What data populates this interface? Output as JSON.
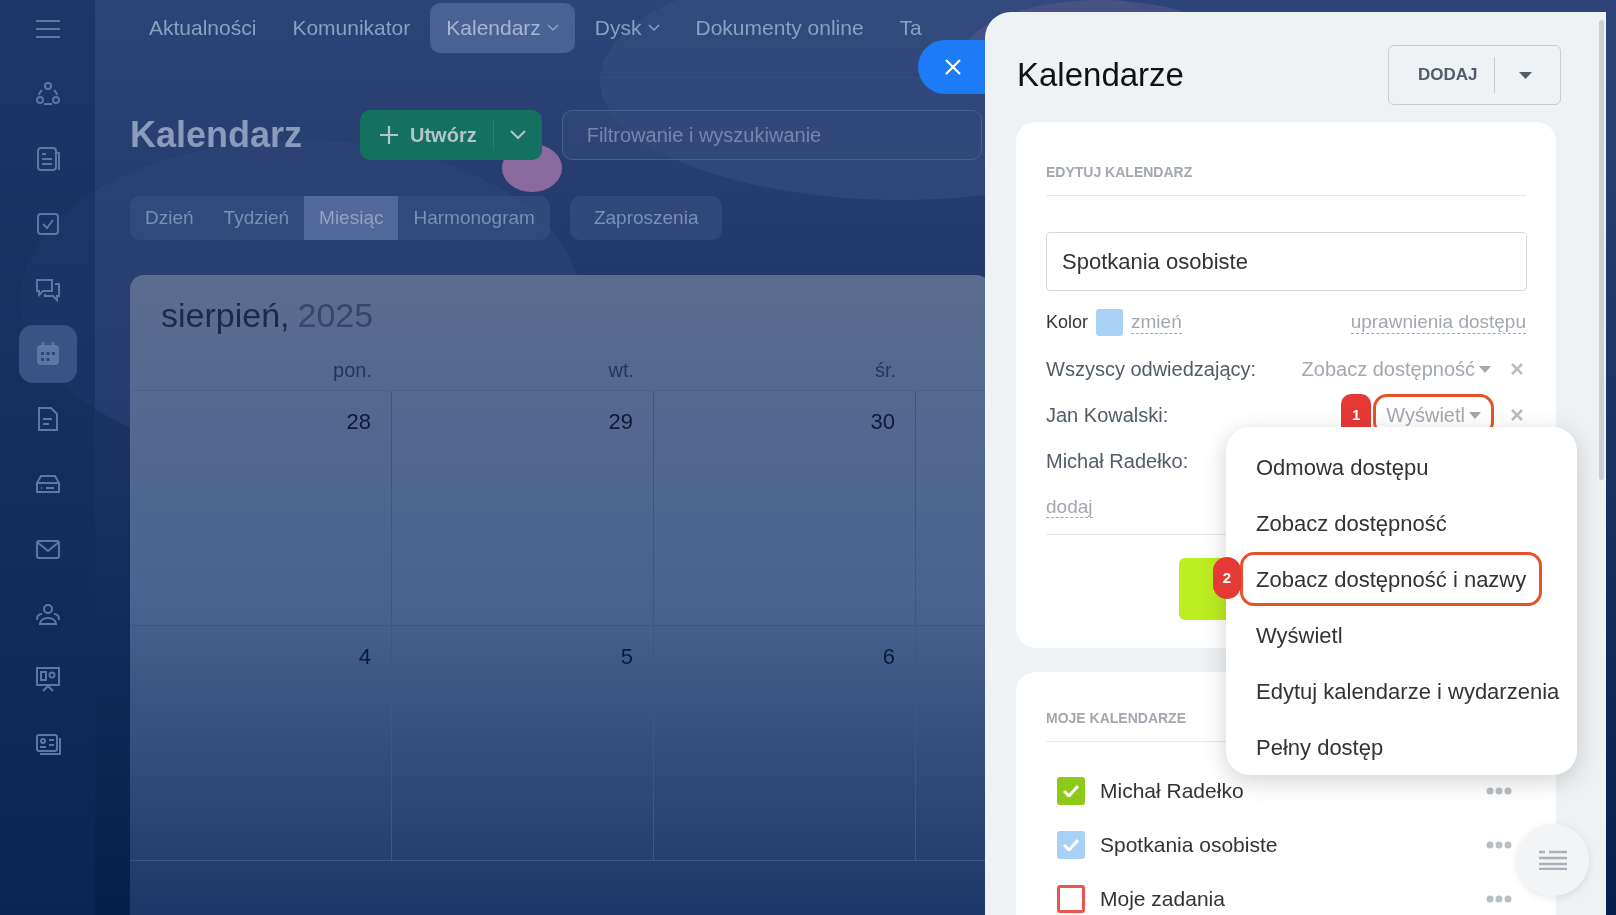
{
  "sidebar": {
    "items": [
      {
        "selected": false
      },
      {
        "selected": false
      },
      {
        "selected": false
      },
      {
        "selected": false
      },
      {
        "selected": true
      },
      {
        "selected": false
      },
      {
        "selected": false
      },
      {
        "selected": false
      },
      {
        "selected": false
      },
      {
        "selected": false
      },
      {
        "selected": false
      }
    ]
  },
  "nav": {
    "items": [
      {
        "label": "Aktualności",
        "selected": false,
        "has_menu": false
      },
      {
        "label": "Komunikator",
        "selected": false,
        "has_menu": false
      },
      {
        "label": "Kalendarz",
        "selected": true,
        "has_menu": true
      },
      {
        "label": "Dysk",
        "selected": false,
        "has_menu": true
      },
      {
        "label": "Dokumenty online",
        "selected": false,
        "has_menu": false
      },
      {
        "label": "Ta",
        "selected": false,
        "has_menu": false
      }
    ]
  },
  "page": {
    "title": "Kalendarz",
    "create_button": "Utwórz",
    "search": {
      "placeholder": "Filtrowanie i wyszukiwanie"
    },
    "views": [
      {
        "label": "Dzień",
        "selected": false
      },
      {
        "label": "Tydzień",
        "selected": false
      },
      {
        "label": "Miesiąc",
        "selected": true
      },
      {
        "label": "Harmonogram",
        "selected": false
      }
    ],
    "invitations": "Zaproszenia"
  },
  "calendar": {
    "month": "sierpień,",
    "year": "2025",
    "weekdays": [
      "pon.",
      "wt.",
      "śr."
    ],
    "weeks": [
      [
        "28",
        "29",
        "30"
      ],
      [
        "4",
        "5",
        "6"
      ]
    ]
  },
  "panel": {
    "title": "Kalendarze",
    "add_button": "DODAJ",
    "edit": {
      "heading": "EDYTUJ KALENDARZ",
      "name": "Spotkania osobiste",
      "color_label": "Kolor",
      "color": "#a8d1f5",
      "change_link": "zmień",
      "access_link": "uprawnienia dostępu",
      "access": [
        {
          "name": "Wszyscy odwiedzający:",
          "value": "Zobacz dostępność"
        },
        {
          "name": "Jan Kowalski:",
          "value": "Wyświetl",
          "callout": "1"
        },
        {
          "name": "Michał Radełko:"
        }
      ],
      "add_link": "dodaj"
    },
    "my_calendars": {
      "heading": "MOJE KALENDARZE",
      "items": [
        {
          "label": "Michał Radełko",
          "checked": true,
          "color": "#8dc919"
        },
        {
          "label": "Spotkania osobiste",
          "checked": true,
          "color": "#a8d1f5"
        },
        {
          "label": "Moje zadania",
          "checked": false,
          "color": "#e8574e"
        }
      ]
    }
  },
  "access_menu": {
    "items": [
      {
        "label": "Odmowa dostępu",
        "selected": false
      },
      {
        "label": "Zobacz dostępność",
        "selected": false
      },
      {
        "label": "Zobacz dostępność i nazwy",
        "selected": true,
        "callout": "2"
      },
      {
        "label": "Wyświetl",
        "selected": false
      },
      {
        "label": "Edytuj kalendarze i wydarzenia",
        "selected": false
      },
      {
        "label": "Pełny dostęp",
        "selected": false
      }
    ]
  }
}
